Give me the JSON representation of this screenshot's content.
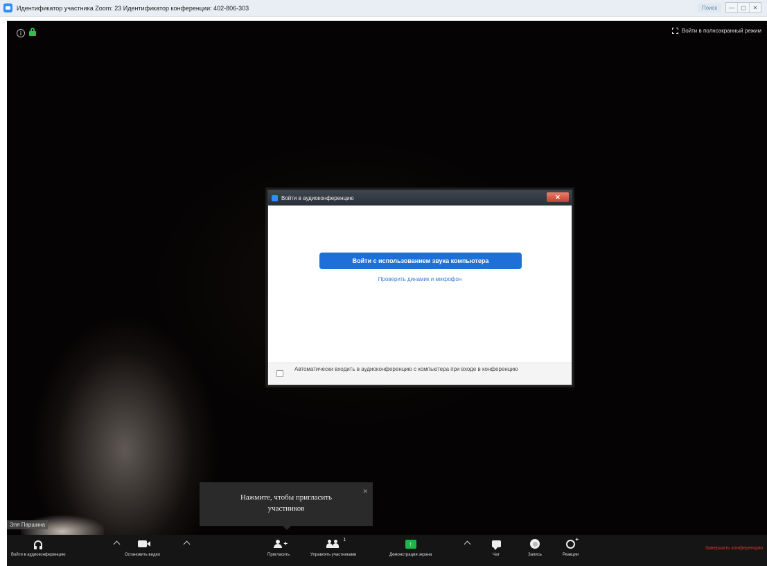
{
  "window": {
    "title": "Идентификатор участника Zoom: 23   Идентификатор конференции: 402-806-303",
    "search_chip": "Поиск",
    "controls": [
      "—",
      "▢",
      "✕"
    ]
  },
  "meeting": {
    "fullscreen_label": "Войти в полноэкранный режим",
    "participant_name": "Эля Паршина"
  },
  "dialog": {
    "title": "Войти в аудиоконференцию",
    "join_button": "Войти с использованием звука компьютера",
    "test_link": "Проверить динамик и микрофон",
    "auto_join_label": "Автоматически входить в аудиоконференцию с компьютера при входе в конференцию",
    "auto_join_checked": false
  },
  "tooltip": {
    "line1": "Нажмите, чтобы пригласить",
    "line2": "участников",
    "close": "✕"
  },
  "toolbar": {
    "join_audio": "Войти в аудиоконференцию",
    "stop_video": "Остановить видео",
    "invite": "Пригласить",
    "manage_participants": "Управлять участниками",
    "participants_count": "1",
    "share_screen": "Демонстрация экрана",
    "chat": "Чат",
    "record": "Запись",
    "reactions": "Реакции",
    "end_meeting": "Завершить конференцию"
  },
  "colors": {
    "accent": "#1f6fd8",
    "share_green": "#22b34a",
    "end_red": "#e0332b",
    "lock_green": "#2fbf4a"
  }
}
